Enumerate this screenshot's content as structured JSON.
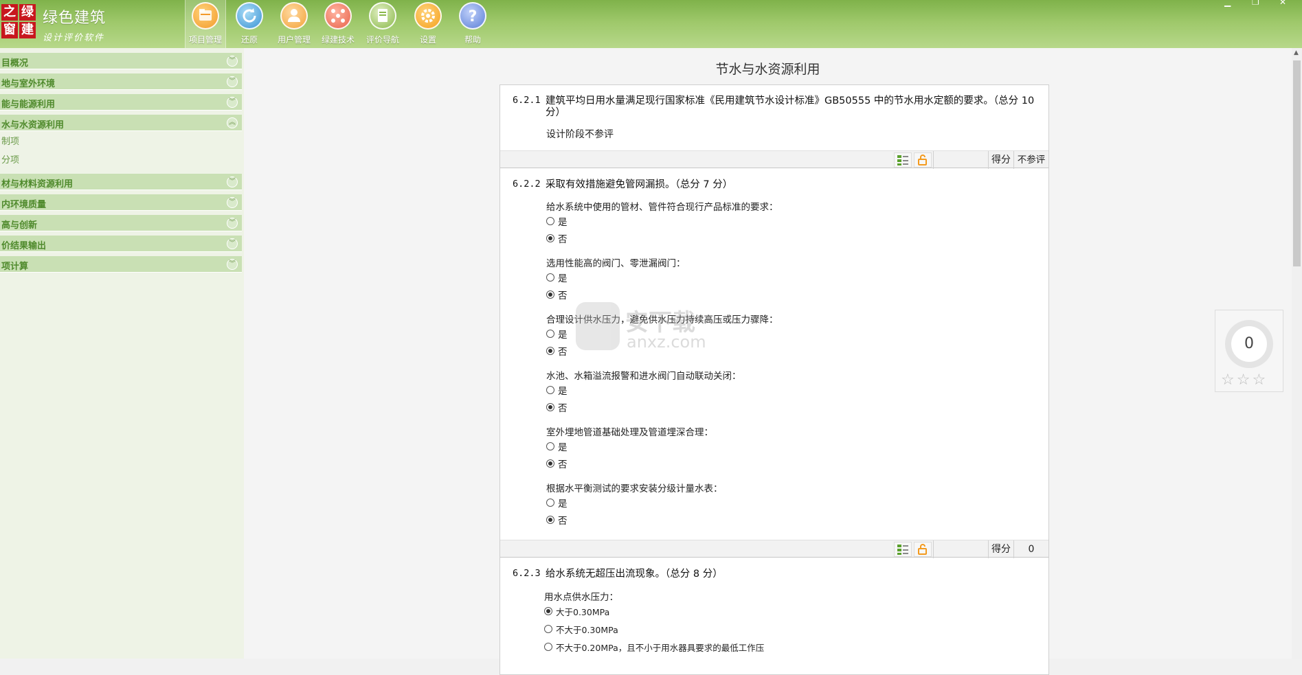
{
  "app": {
    "logo_chars": [
      "之",
      "绿",
      "窗",
      "建"
    ],
    "brand_name": "绿色建筑",
    "brand_sub": "设计评价软件",
    "colors": {
      "header": "#8fbf58",
      "sidebar_section": "#c9e0b4",
      "sidebar_text": "#4f8a2c"
    }
  },
  "toolbar": [
    {
      "label": "项目管理",
      "icon": "folder-icon",
      "color": "#f39a2a"
    },
    {
      "label": "还原",
      "icon": "refresh-icon",
      "color": "#4aa3df"
    },
    {
      "label": "用户管理",
      "icon": "users-icon",
      "color": "#f3a23a"
    },
    {
      "label": "绿建技术",
      "icon": "network-icon",
      "color": "#e8634a"
    },
    {
      "label": "评价导航",
      "icon": "book-icon",
      "color": "#8ab84a"
    },
    {
      "label": "设置",
      "icon": "gear-icon",
      "color": "#f5a11e"
    },
    {
      "label": "帮助",
      "icon": "help-icon",
      "color": "#5b7fd6"
    }
  ],
  "sidebar": {
    "sections": [
      {
        "label": "目概况",
        "expanded": false
      },
      {
        "label": "地与室外环境",
        "expanded": false
      },
      {
        "label": "能与能源利用",
        "expanded": false
      },
      {
        "label": "水与水资源利用",
        "expanded": true,
        "children": [
          "制项",
          "分项"
        ]
      },
      {
        "label": "材与材料资源利用",
        "expanded": false
      },
      {
        "label": "内环境质量",
        "expanded": false
      },
      {
        "label": "高与创新",
        "expanded": false
      },
      {
        "label": "价结果输出",
        "expanded": false
      },
      {
        "label": "项计算",
        "expanded": false
      }
    ]
  },
  "main": {
    "title": "节水与水资源利用",
    "q1": {
      "num": "6.2.1",
      "text": "建筑平均日用水量满足现行国家标准《民用建筑节水设计标准》GB50555 中的节水用水定额的要求。（总分 10 分）",
      "note": "设计阶段不参评",
      "score_label": "得分",
      "score_value": "不参评"
    },
    "q2": {
      "num": "6.2.2",
      "text": "采取有效措施避免管网漏损。（总分 7 分）",
      "items": [
        {
          "label": "给水系统中使用的管材、管件符合现行产品标准的要求：",
          "yes": "是",
          "no": "否",
          "selected": "no"
        },
        {
          "label": "选用性能高的阀门、零泄漏阀门：",
          "yes": "是",
          "no": "否",
          "selected": "no"
        },
        {
          "label": "合理设计供水压力，避免供水压力持续高压或压力骤降：",
          "yes": "是",
          "no": "否",
          "selected": "no"
        },
        {
          "label": "水池、水箱溢流报警和进水阀门自动联动关闭：",
          "yes": "是",
          "no": "否",
          "selected": "no"
        },
        {
          "label": "室外埋地管道基础处理及管道埋深合理：",
          "yes": "是",
          "no": "否",
          "selected": "no"
        },
        {
          "label": "根据水平衡测试的要求安装分级计量水表：",
          "yes": "是",
          "no": "否",
          "selected": "no"
        }
      ],
      "score_label": "得分",
      "score_value": "0"
    },
    "q3": {
      "num": "6.2.3",
      "text": "给水系统无超压出流现象。（总分 8 分）",
      "sub_label": "用水点供水压力：",
      "options": [
        "大于0.30MPa",
        "不大于0.30MPa",
        "不大于0.20MPa，且不小于用水器具要求的最低工作压"
      ],
      "selected_index": 0
    }
  },
  "widget": {
    "score": "0",
    "stars_total": 3,
    "stars_filled": 0
  },
  "watermark": {
    "brand": "安下载",
    "domain": "anxz.com"
  }
}
